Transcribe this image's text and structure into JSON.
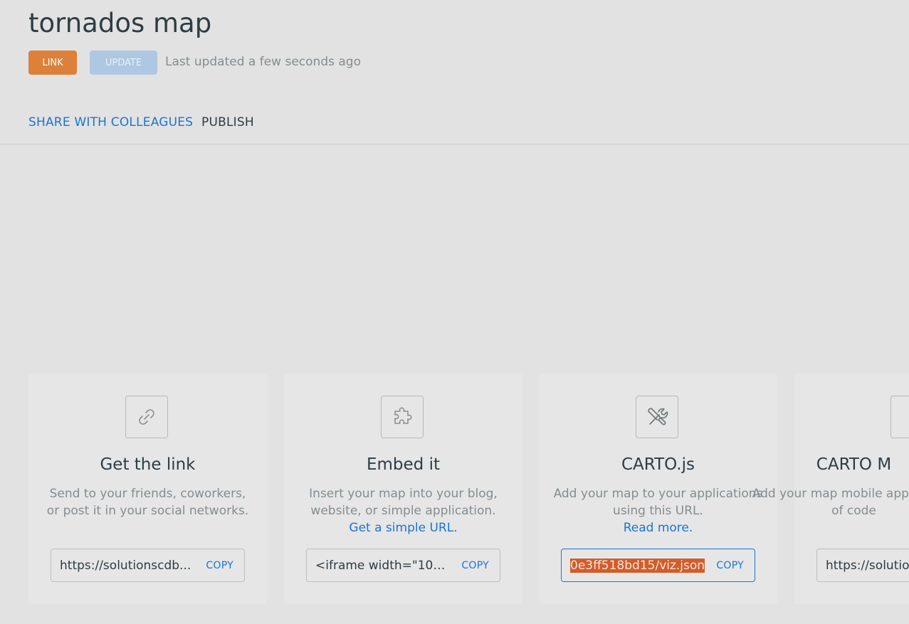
{
  "header": {
    "title": "tornados map",
    "link_button": "LINK",
    "update_button": "UPDATE",
    "last_updated": "Last updated a few seconds ago"
  },
  "tabs": [
    {
      "label": "SHARE WITH COLLEAGUES",
      "active": false
    },
    {
      "label": "PUBLISH",
      "active": true
    }
  ],
  "cards": [
    {
      "icon": "link-icon",
      "title": "Get the link",
      "description": "Send to your friends, coworkers, or post it in your social networks.",
      "link": "",
      "value": "https://solutionscdb...",
      "copy_label": "COPY"
    },
    {
      "icon": "puzzle-icon",
      "title": "Embed it",
      "description": "Insert your map into your blog, website, or simple application.",
      "link": "Get a simple URL.",
      "value": "<iframe width=\"100...",
      "copy_label": "COPY"
    },
    {
      "icon": "tools-icon",
      "title": "CARTO.js",
      "description": "Add your map to your applications using this URL.",
      "link": "Read more.",
      "value": "0e3ff518bd15/viz.json",
      "copy_label": "COPY"
    },
    {
      "icon": "mobile-icon",
      "title": "CARTO M",
      "description": "Add your map mobile applica line of code",
      "link": "",
      "value": "https://solutio",
      "copy_label": ""
    }
  ],
  "colors": {
    "accent": "#1b74d3",
    "link_button": "#dd8039",
    "update_button": "#aec8e2",
    "selection": "#d05d2b"
  }
}
